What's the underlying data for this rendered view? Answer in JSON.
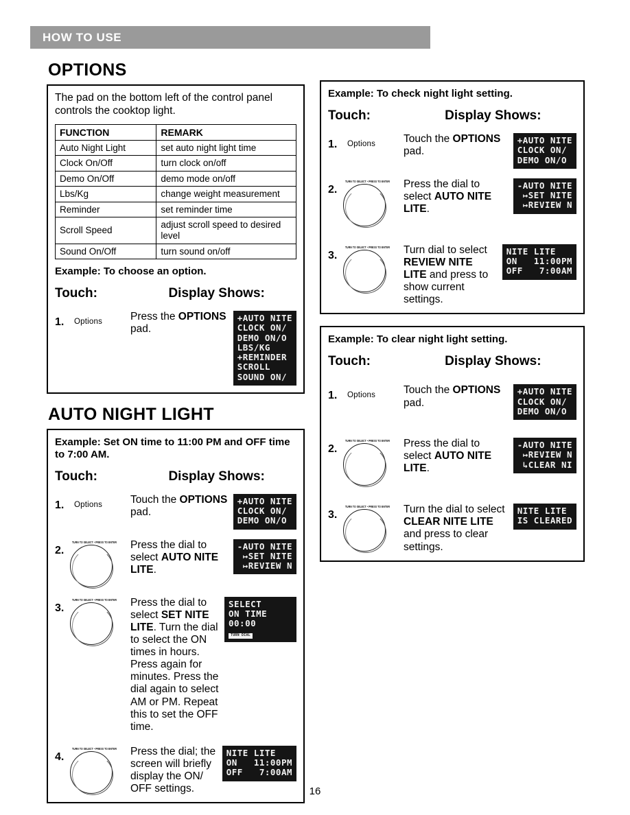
{
  "header": {
    "title": "HOW TO USE"
  },
  "page_number": "16",
  "sections": {
    "options": {
      "heading": "OPTIONS",
      "intro": "The pad on the bottom left of the control panel controls the cooktop light.",
      "table": {
        "columns": [
          "FUNCTION",
          "REMARK"
        ],
        "rows": [
          [
            "Auto Night Light",
            "set auto night light time"
          ],
          [
            "Clock On/Off",
            "turn clock on/off"
          ],
          [
            "Demo On/Off",
            "demo mode on/off"
          ],
          [
            "Lbs/Kg",
            "change weight measurement"
          ],
          [
            "Reminder",
            "set reminder time"
          ],
          [
            "Scroll Speed",
            "adjust scroll speed to desired level"
          ],
          [
            "Sound On/Off",
            "turn sound on/off"
          ]
        ]
      },
      "example_label": "Example: To choose an option.",
      "touch_header": "Touch:",
      "display_header": "Display Shows:",
      "steps": [
        {
          "num": "1.",
          "control": "pad",
          "control_label": "Options",
          "text_plain_1": "Press the ",
          "text_bold": "OPTIONS",
          "text_plain_2": " pad.",
          "lcd": "+AUTO NITE\nCLOCK ON∕\nDEMO ON∕O\nLBS∕KG\n+REMINDER\nSCROLL\nSOUND ON∕"
        }
      ]
    },
    "auto_night_light": {
      "heading": "AUTO NIGHT LIGHT",
      "example_label": "Example: Set ON time to 11:00 PM and OFF time to 7:00 AM.",
      "touch_header": "Touch:",
      "display_header": "Display Shows:",
      "dial_caption": "TURN TO SELECT • PRESS TO ENTER",
      "steps": [
        {
          "num": "1.",
          "control": "pad",
          "control_label": "Options",
          "text_plain_1": "Touch the ",
          "text_bold": "OPTIONS",
          "text_plain_2": " pad.",
          "lcd": "+AUTO NITE\nCLOCK ON∕\nDEMO ON∕O"
        },
        {
          "num": "2.",
          "control": "dial",
          "text_plain_1": "Press the dial to select ",
          "text_bold": "AUTO NITE LITE",
          "text_plain_2": ".",
          "lcd": "-AUTO NITE\n ↦SET NITE\n ↦REVIEW N"
        },
        {
          "num": "3.",
          "control": "dial",
          "text_plain_1": "Press the dial to select ",
          "text_bold": "SET NITE LITE",
          "text_plain_2": ". Turn the dial to select the ON times in hours. Press again for minutes. Press the dial again to select AM or PM. Repeat this to set the OFF time.",
          "lcd": "SELECT\nON TIME\n00:00",
          "lcd_badge": "TURN DIAL"
        },
        {
          "num": "4.",
          "control": "dial",
          "text_plain_1": "Press the dial; the screen will briefly display the ON/ OFF settings.",
          "text_bold": "",
          "text_plain_2": "",
          "lcd": "NITE LITE\nON   11:00PM\nOFF   7:00AM"
        }
      ]
    },
    "check_night_light": {
      "example_label": "Example: To check night light setting.",
      "touch_header": "Touch:",
      "display_header": "Display Shows:",
      "dial_caption": "TURN TO SELECT • PRESS TO ENTER",
      "steps": [
        {
          "num": "1.",
          "control": "pad",
          "control_label": "Options",
          "text_plain_1": "Touch the ",
          "text_bold": "OPTIONS",
          "text_plain_2": " pad.",
          "lcd": "+AUTO NITE\nCLOCK ON∕\nDEMO ON∕O"
        },
        {
          "num": "2.",
          "control": "dial",
          "text_plain_1": "Press the dial to select ",
          "text_bold": "AUTO NITE LITE",
          "text_plain_2": ".",
          "lcd": "-AUTO NITE\n ↦SET NITE\n ↦REVIEW N"
        },
        {
          "num": "3.",
          "control": "dial",
          "text_plain_1": "Turn dial to select ",
          "text_bold": "REVIEW NITE LITE",
          "text_plain_2": " and press to show current settings.",
          "lcd": "NITE LITE\nON   11:00PM\nOFF   7:00AM"
        }
      ]
    },
    "clear_night_light": {
      "example_label": "Example: To clear night light setting.",
      "touch_header": "Touch:",
      "display_header": "Display Shows:",
      "dial_caption": "TURN TO SELECT • PRESS TO ENTER",
      "steps": [
        {
          "num": "1.",
          "control": "pad",
          "control_label": "Options",
          "text_plain_1": "Touch the ",
          "text_bold": "OPTIONS",
          "text_plain_2": " pad.",
          "lcd": "+AUTO NITE\nCLOCK ON∕\nDEMO ON∕O"
        },
        {
          "num": "2.",
          "control": "dial",
          "text_plain_1": "Press the dial to select ",
          "text_bold": "AUTO NITE LITE",
          "text_plain_2": ".",
          "lcd": "-AUTO NITE\n ↦REVIEW N\n ↳CLEAR NI"
        },
        {
          "num": "3.",
          "control": "dial",
          "text_plain_1": "Turn the dial to select ",
          "text_bold": "CLEAR NITE LITE",
          "text_plain_2": " and press to clear settings.",
          "lcd": "NITE LITE\nIS CLEARED"
        }
      ]
    }
  },
  "colors": {
    "header_bar": "#9a9a9a",
    "lcd_background": "#151515",
    "lcd_text": "#f2f2f2"
  }
}
